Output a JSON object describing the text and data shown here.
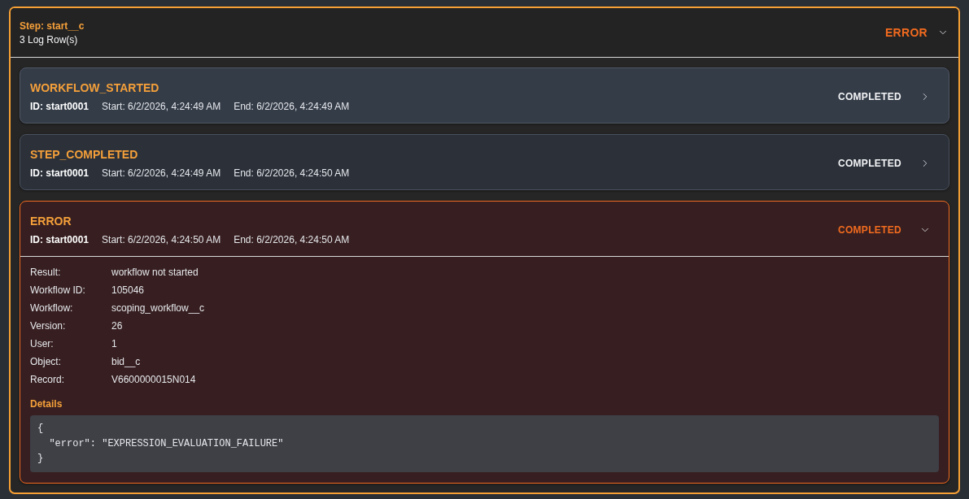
{
  "step": {
    "title": "Step: start__c",
    "row_count": "3 Log Row(s)",
    "status": "ERROR",
    "expanded": true
  },
  "log_rows": [
    {
      "kind": "event",
      "title": "WORKFLOW_STARTED",
      "id": "ID: start0001",
      "start": "Start: 6/2/2026, 4:24:49 AM",
      "end": "End: 6/2/2026, 4:24:49 AM",
      "status": "COMPLETED",
      "highlighted": true,
      "expanded": false
    },
    {
      "kind": "event",
      "title": "STEP_COMPLETED",
      "id": "ID: start0001",
      "start": "Start: 6/2/2026, 4:24:49 AM",
      "end": "End: 6/2/2026, 4:24:50 AM",
      "status": "COMPLETED",
      "highlighted": false,
      "expanded": false
    },
    {
      "kind": "error",
      "title": "ERROR",
      "id": "ID: start0001",
      "start": "Start: 6/2/2026, 4:24:50 AM",
      "end": "End: 6/2/2026, 4:24:50 AM",
      "status": "COMPLETED",
      "highlighted": false,
      "expanded": true,
      "fields": [
        {
          "label": "Result:",
          "value": "workflow not started"
        },
        {
          "label": "Workflow ID:",
          "value": "105046"
        },
        {
          "label": "Workflow:",
          "value": "scoping_workflow__c"
        },
        {
          "label": "Version:",
          "value": "26"
        },
        {
          "label": "User:",
          "value": "1"
        },
        {
          "label": "Object:",
          "value": "bid__c"
        },
        {
          "label": "Record:",
          "value": "V6600000015N014"
        }
      ],
      "details": {
        "heading": "Details",
        "code": "{\n  \"error\": \"EXPRESSION_EVALUATION_FAILURE\"\n}"
      }
    }
  ]
}
